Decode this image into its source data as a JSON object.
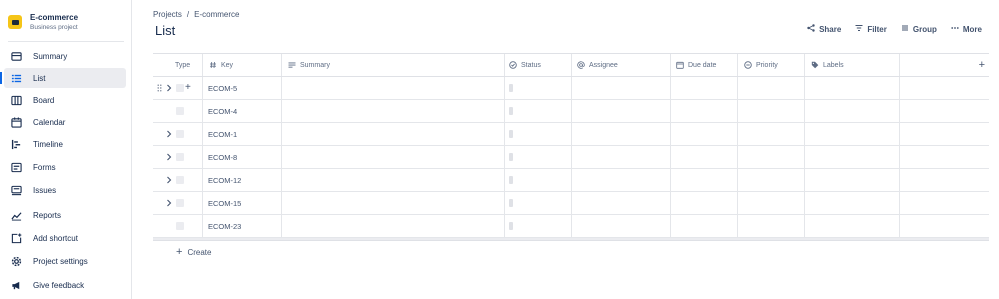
{
  "project": {
    "name": "E-commerce",
    "type": "Business project"
  },
  "sidebar": {
    "items": [
      {
        "label": "Summary",
        "icon": "summary-icon"
      },
      {
        "label": "List",
        "icon": "list-icon",
        "active": true
      },
      {
        "label": "Board",
        "icon": "board-icon"
      },
      {
        "label": "Calendar",
        "icon": "calendar-icon"
      },
      {
        "label": "Timeline",
        "icon": "timeline-icon"
      },
      {
        "label": "Forms",
        "icon": "forms-icon"
      },
      {
        "label": "Issues",
        "icon": "issues-icon"
      },
      {
        "label": "Reports",
        "icon": "reports-icon"
      },
      {
        "label": "Add shortcut",
        "icon": "add-shortcut-icon"
      },
      {
        "label": "Project settings",
        "icon": "gear-icon"
      },
      {
        "label": "Give feedback",
        "icon": "megaphone-icon"
      }
    ]
  },
  "breadcrumb": {
    "projects": "Projects",
    "separator": "/",
    "current": "E-commerce"
  },
  "page": {
    "title": "List"
  },
  "toolbar": {
    "share": "Share",
    "filter": "Filter",
    "group": "Group",
    "more": "More"
  },
  "table": {
    "columns": {
      "type": "Type",
      "key": "Key",
      "summary": "Summary",
      "status": "Status",
      "assignee": "Assignee",
      "due_date": "Due date",
      "priority": "Priority",
      "labels": "Labels"
    },
    "add_column": "+",
    "rows": [
      {
        "key": "ECOM-5",
        "expandable": true,
        "hovered": true
      },
      {
        "key": "ECOM-4",
        "expandable": false
      },
      {
        "key": "ECOM-1",
        "expandable": true
      },
      {
        "key": "ECOM-8",
        "expandable": true
      },
      {
        "key": "ECOM-12",
        "expandable": true
      },
      {
        "key": "ECOM-15",
        "expandable": true
      },
      {
        "key": "ECOM-23",
        "expandable": false
      }
    ]
  },
  "create": {
    "label": "Create"
  },
  "colors": {
    "accent": "#0c66e4",
    "brand": "#f5c518",
    "text": "#172b4d",
    "muted": "#44546f"
  }
}
